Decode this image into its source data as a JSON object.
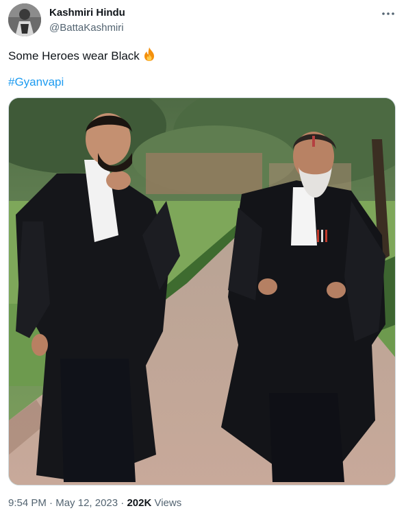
{
  "author": {
    "display_name": "Kashmiri Hindu",
    "handle": "@BattaKashmiri",
    "avatar_icon": "profile-photo"
  },
  "tweet": {
    "text": "Some Heroes wear Black",
    "emoji_icon": "fire-icon",
    "hashtag": "#Gyanvapi"
  },
  "media": {
    "type": "photo",
    "description_icon": "two-lawyers-walking-photo"
  },
  "meta": {
    "time": "9:54 PM",
    "separator1": " · ",
    "date": "May 12, 2023",
    "separator2": " · ",
    "views_count": "202K",
    "views_label": " Views"
  },
  "colors": {
    "link": "#1d9bf0",
    "secondary_text": "#536471",
    "primary_text": "#0f1419"
  }
}
